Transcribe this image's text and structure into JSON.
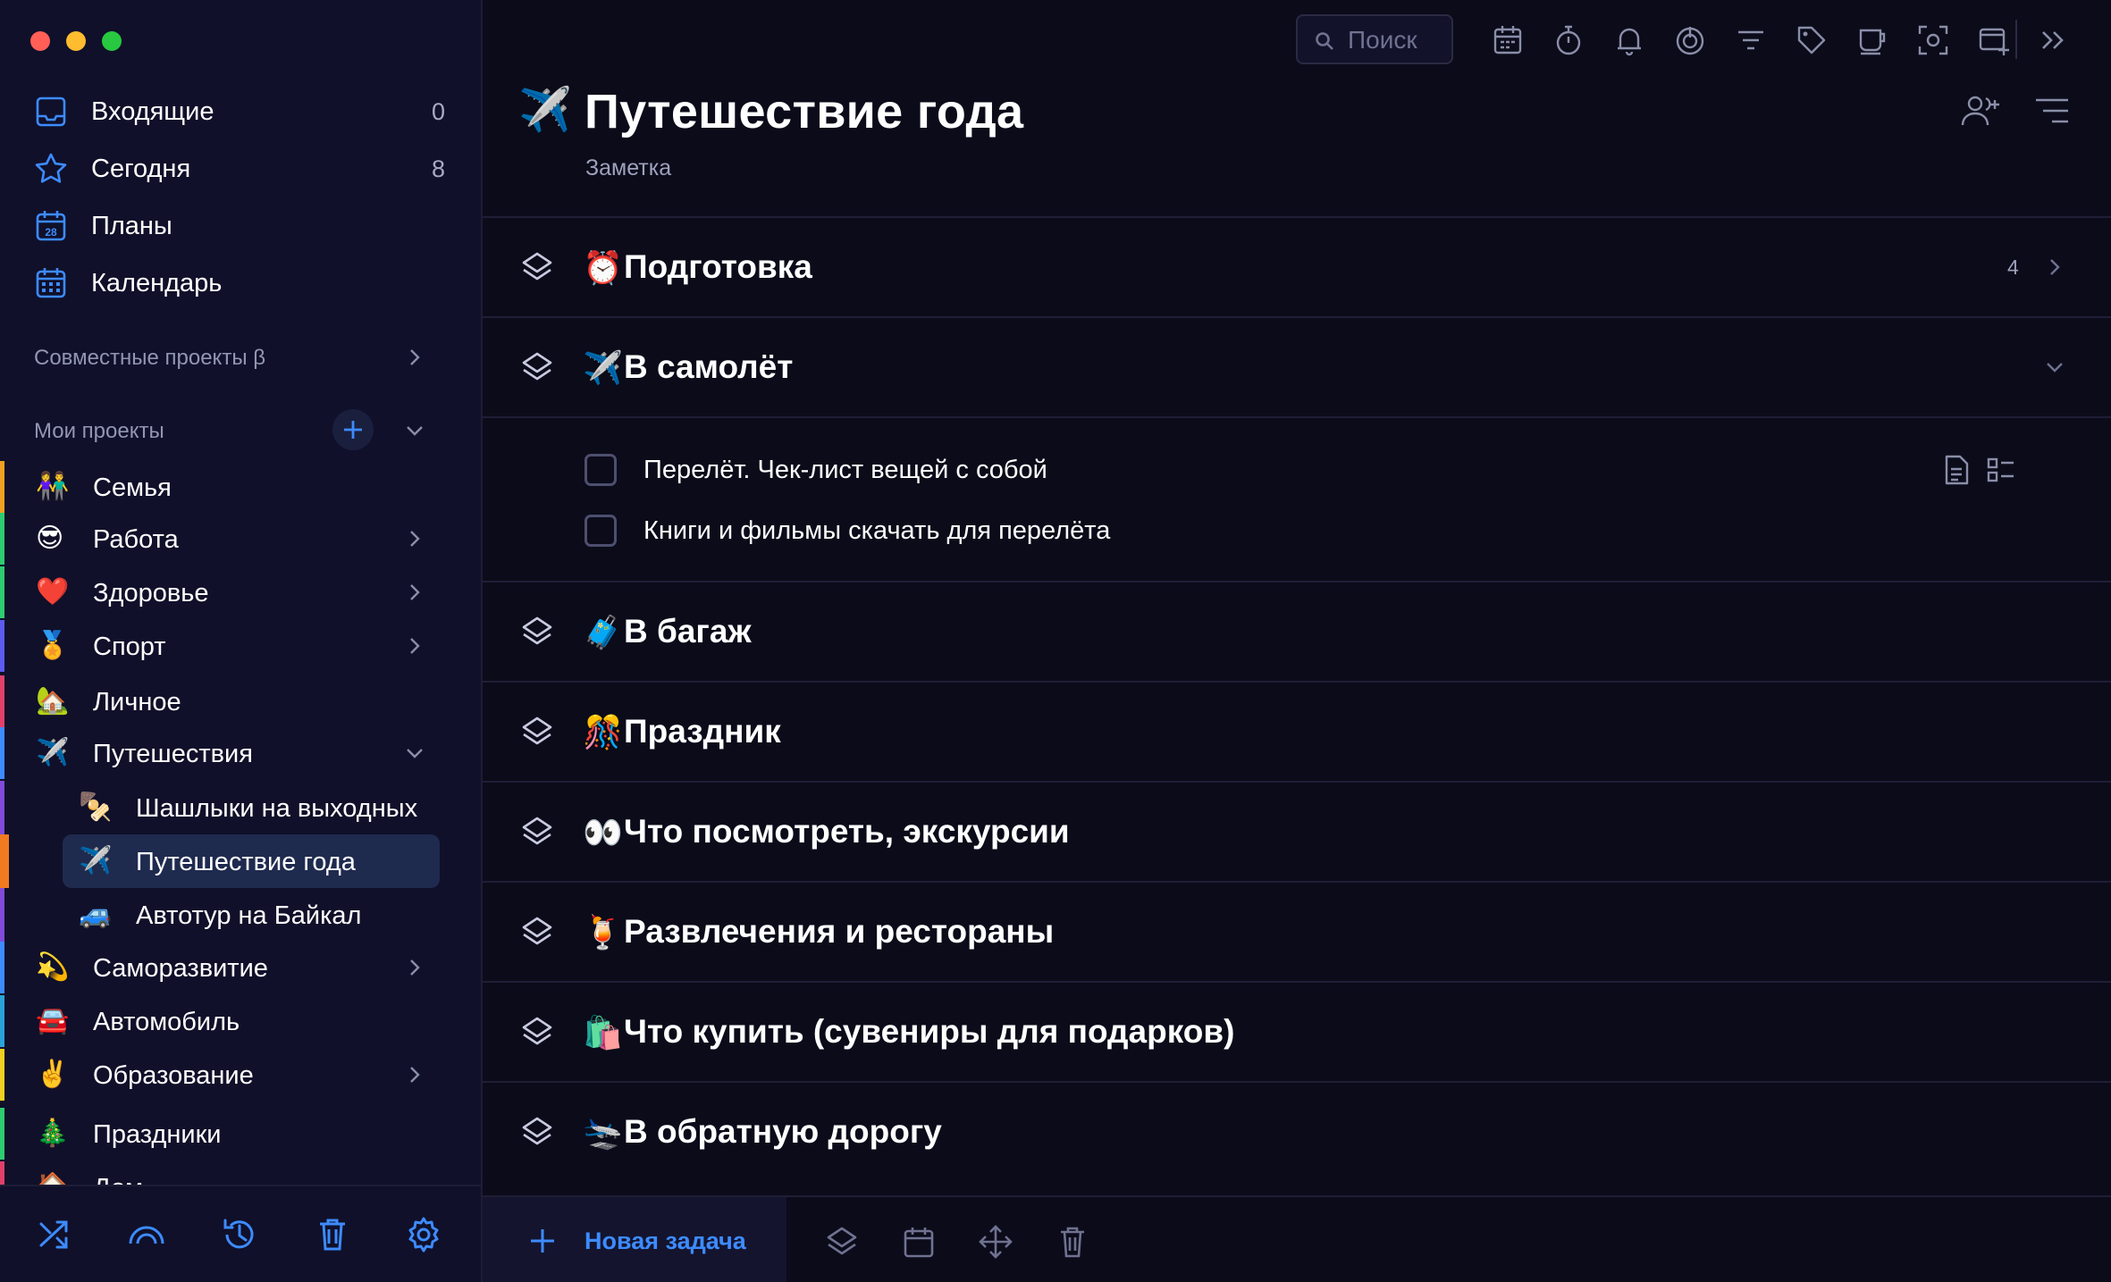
{
  "window": {
    "traffic_lights": [
      "#ff5f57",
      "#febc2e",
      "#28c840"
    ]
  },
  "colors": {
    "accent": "#3d8bff",
    "icon": "#3d8bff",
    "active_bg": "#1f2a4f"
  },
  "sidebar": {
    "nav": [
      {
        "label": "Входящие",
        "count": "0",
        "icon": "inbox-icon"
      },
      {
        "label": "Сегодня",
        "count": "8",
        "icon": "star-icon"
      },
      {
        "label": "Планы",
        "count": "",
        "icon": "calendar-28-icon"
      },
      {
        "label": "Календарь",
        "count": "",
        "icon": "calendar-grid-icon"
      }
    ],
    "shared_projects": "Совместные проекты β",
    "my_projects": "Мои проекты",
    "projects": [
      {
        "emoji": "👫",
        "label": "Семья",
        "stripe": "#f0a020"
      },
      {
        "emoji": "😎",
        "label": "Работа",
        "stripe": "#2ecc71"
      },
      {
        "emoji": "❤️",
        "label": "Здоровье",
        "stripe": "#2ecc71"
      },
      {
        "emoji": "🏅",
        "label": "Спорт",
        "stripe": "#5b5bf0"
      },
      {
        "emoji": "🏡",
        "label": "Личное",
        "stripe": "#e0406a"
      },
      {
        "emoji": "✈️",
        "label": "Путешествия",
        "stripe": "#3d8bff"
      }
    ],
    "subprojects": [
      {
        "emoji": "🍢",
        "label": "Шашлыки на выходных",
        "stripe": "#7f4bd8"
      },
      {
        "emoji": "✈️",
        "label": "Путешествие года",
        "stripe": "#f07a20"
      },
      {
        "emoji": "🚙",
        "label": "Автотур на Байкал",
        "stripe": "#2aa3d8"
      }
    ],
    "projects2": [
      {
        "emoji": "💫",
        "label": "Саморазвитие",
        "stripe": "#3d8bff"
      },
      {
        "emoji": "🚘",
        "label": "Автомобиль",
        "stripe": "#2aa3d8"
      },
      {
        "emoji": "✌️",
        "label": "Образование",
        "stripe": "#f0d020"
      },
      {
        "emoji": "🎄",
        "label": "Праздники",
        "stripe": "#2ecc71"
      },
      {
        "emoji": "🏠",
        "label": "Дом",
        "stripe": "#e0406a"
      }
    ]
  },
  "toolbar": {
    "search_placeholder": "Поиск"
  },
  "page": {
    "icon": "✈️",
    "title": "Путешествие года",
    "note": "Заметка"
  },
  "sections": [
    {
      "emoji": "⏰",
      "title": "Подготовка",
      "count": "4",
      "state": "collapsed"
    },
    {
      "emoji": "✈️",
      "title": "В самолёт",
      "count": "",
      "state": "expanded"
    },
    {
      "emoji": "🧳",
      "title": "В багаж",
      "count": ""
    },
    {
      "emoji": "🎊",
      "title": "Праздник",
      "count": ""
    },
    {
      "emoji": "👀",
      "title": "Что посмотреть, экскурсии",
      "count": ""
    },
    {
      "emoji": "🍹",
      "title": "Развлечения и рестораны",
      "count": ""
    },
    {
      "emoji": "🛍️",
      "title": "Что купить (сувениры для подарков)",
      "count": ""
    },
    {
      "emoji": "🛬",
      "title": "В обратную дорогу",
      "count": ""
    }
  ],
  "tasks": [
    {
      "label": "Перелёт. Чек-лист вещей с собой",
      "has_note": true,
      "has_checklist": true
    },
    {
      "label": "Книги и фильмы скачать для перелёта",
      "has_note": false,
      "has_checklist": false
    }
  ],
  "bottom": {
    "new_task": "Новая задача"
  }
}
